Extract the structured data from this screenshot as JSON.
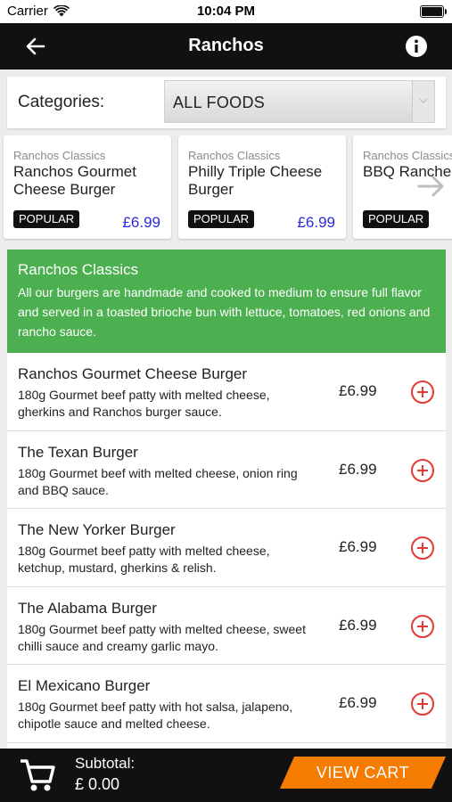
{
  "status_bar": {
    "carrier": "Carrier",
    "time": "10:04 PM"
  },
  "nav": {
    "title": "Ranchos",
    "back_icon": "back-arrow-icon",
    "info_icon": "info-icon"
  },
  "categories": {
    "label": "Categories:",
    "selected": "ALL FOODS"
  },
  "featured": [
    {
      "category": "Ranchos Classics",
      "name": "Ranchos Gourmet Cheese Burger",
      "badge": "POPULAR",
      "price": "£6.99"
    },
    {
      "category": "Ranchos Classics",
      "name": "Philly Triple Cheese Burger",
      "badge": "POPULAR",
      "price": "£6.99"
    },
    {
      "category": "Ranchos Classics",
      "name": "BBQ Rancher",
      "badge": "POPULAR",
      "price": ""
    }
  ],
  "section": {
    "title": "Ranchos Classics",
    "description": "All our burgers are handmade and cooked to medium to ensure full flavor and served in a toasted brioche bun with lettuce, tomatoes, red onions and rancho sauce."
  },
  "items": [
    {
      "name": "Ranchos Gourmet Cheese Burger",
      "description": "180g Gourmet beef patty with melted cheese, gherkins and Ranchos burger sauce.",
      "price": "£6.99"
    },
    {
      "name": "The Texan Burger",
      "description": "180g Gourmet beef with melted cheese, onion ring and BBQ sauce.",
      "price": "£6.99"
    },
    {
      "name": "The New Yorker Burger",
      "description": "180g Gourmet beef patty with melted cheese, ketchup, mustard, gherkins & relish.",
      "price": "£6.99"
    },
    {
      "name": "The Alabama Burger",
      "description": "180g Gourmet beef patty with melted cheese, sweet chilli sauce and creamy garlic mayo.",
      "price": "£6.99"
    },
    {
      "name": "El Mexicano Burger",
      "description": "180g Gourmet beef patty with hot salsa, jalapeno, chipotle sauce and melted cheese.",
      "price": "£6.99"
    }
  ],
  "bottom_bar": {
    "subtotal_label": "Subtotal:",
    "subtotal_value": "£ 0.00",
    "view_cart": "VIEW CART"
  },
  "colors": {
    "accent_green": "#4caf50",
    "add_red": "#e53935",
    "view_cart_orange": "#f57c00",
    "price_blue": "#2a2ad6"
  }
}
